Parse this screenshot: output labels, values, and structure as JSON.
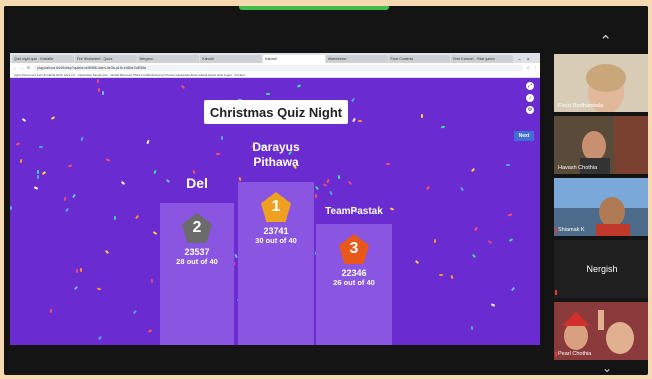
{
  "browser": {
    "tabs": [
      "Quiz night quiz - KhelaBe",
      "Fire Worksheet - Quizz",
      "Mergeon",
      "Kahoot!",
      "Kahoot!",
      "Watermelon",
      "Face Contents",
      "Free Kahoot! - Slide ganes"
    ],
    "active_tab": 4,
    "url": "play.kahoot.it/v2/lobby?quizId=d4f0f96-4de4-4e3b-a1f4-e46be7c8f35a",
    "bookmarks": "Apps   Reconnect from B   Global Work Lifes   LD - CaseClass   Simple Life - Global   Microsoft Office   Fordtheliestransy   Presse Cassandra   Drive   Global Notes   Liste Kuger - Kuckert"
  },
  "quiz": {
    "title": "Christmas Quiz Night",
    "next_label": "Next"
  },
  "podium": [
    {
      "place": "2",
      "name": "Del",
      "score": "23537",
      "correct": "28 out of 40",
      "badge_color": "#6b6b6b"
    },
    {
      "place": "1",
      "name": "Darayus Pithawa",
      "score": "23741",
      "correct": "30 out of 40",
      "badge_color": "#f0a020"
    },
    {
      "place": "3",
      "name": "TeamPastak",
      "score": "22346",
      "correct": "26 out of 40",
      "badge_color": "#e8581a"
    }
  ],
  "participants": [
    {
      "name": "Firoxi Bodhanwala"
    },
    {
      "name": "Havash Chothia"
    },
    {
      "name": "Shiamak K"
    },
    {
      "name": "Nergish"
    },
    {
      "name": "Pearl Chothia"
    }
  ],
  "colors": {
    "kahoot_purple": "#6a2bd0",
    "podium_purple": "#8a55e0",
    "meeting_green": "#3fbf4a"
  }
}
